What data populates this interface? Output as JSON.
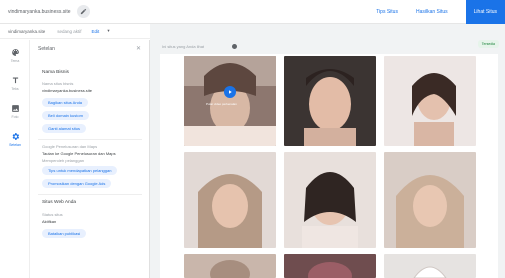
{
  "header": {
    "site_name": "vindimaryanka.business.site",
    "links": [
      "Tips Situs",
      "Hasilkan Situs"
    ],
    "publish_label": "Lihat Situs"
  },
  "subbar": {
    "name": "vindimaryanka.site",
    "status": "sedang aktif",
    "edit_label": "Edit"
  },
  "rail": {
    "items": [
      {
        "label": "Tema",
        "icon": "palette-icon"
      },
      {
        "label": "Teks",
        "icon": "text-icon"
      },
      {
        "label": "Foto",
        "icon": "photo-icon"
      },
      {
        "label": "Setelan",
        "icon": "gear-icon"
      }
    ]
  },
  "panel": {
    "title": "Setelan",
    "business_title": "Nama Bisnis",
    "business_field_label": "Nama situs bisnis",
    "business_value": "vindimaryanka.business.site",
    "btn_share": "Bagikan situs Anda",
    "btn_domain": "Beli domain kustom",
    "btn_edit_address": "Ganti alamat situs",
    "google_field_label": "Google Penelusuran dan Maps",
    "google_value": "Tautan ke Google Penelusuran dan Maps",
    "customers_label": "Memperoleh pelanggan",
    "btn_customers": "Tips untuk mendapatkan pelanggan",
    "btn_google_ads": "Promosikan dengan Google Ads",
    "website_title": "Situs Web Anda",
    "status_label": "Status situs",
    "status_value": "Aktifkan",
    "btn_unpublish": "Batalkan publikasi"
  },
  "canvas": {
    "note": "Ini situs yang Anda lihat",
    "badge": "Tersedia"
  },
  "gallery": {
    "play_label": "Putar video perkenalan"
  },
  "colors": {
    "accent": "#1a73e8",
    "canvas_bg": "#f1f3f4",
    "pill_bg": "#e8f0fe"
  }
}
